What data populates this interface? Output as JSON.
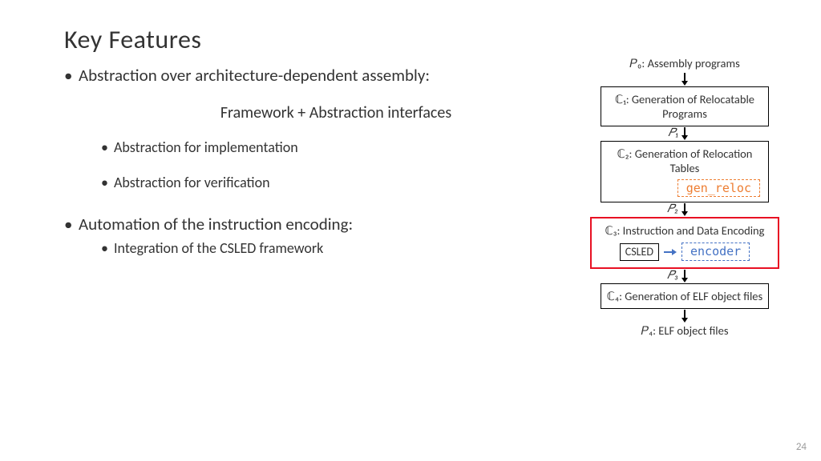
{
  "title": "Key Features",
  "bullets": {
    "b1": "Abstraction over architecture-dependent assembly:",
    "sub_heading": "Framework + Abstraction interfaces",
    "b1a": "Abstraction for implementation",
    "b1b": "Abstraction for verification",
    "b2": "Automation of the instruction encoding:",
    "b2a": "Integration of the CSLED framework"
  },
  "diagram": {
    "p0": "𝑃₀: Assembly programs",
    "c1": "ℂ₁: Generation of Relocatable Programs",
    "p1": "𝑃₁",
    "c2": "ℂ₂: Generation of Relocation Tables",
    "gen_reloc": "gen_reloc",
    "p2": "𝑃₂",
    "c3": "ℂ₃: Instruction and Data Encoding",
    "csled": "CSLED",
    "encoder": "encoder",
    "p3": "𝑃₃",
    "c4": "ℂ₄: Generation of ELF object files",
    "p4": "𝑃₄: ELF object files"
  },
  "page_number": "24"
}
